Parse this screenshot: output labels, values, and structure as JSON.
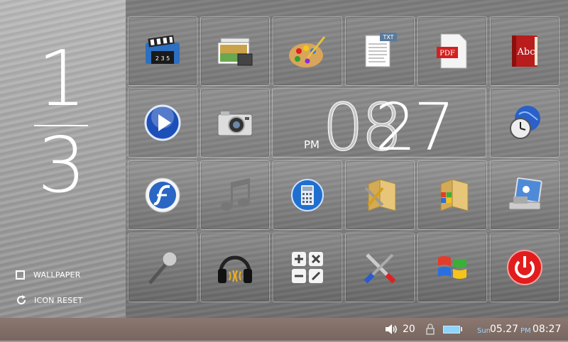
{
  "page_indicator": {
    "current": "1",
    "total": "3"
  },
  "options": {
    "wallpaper": "WALLPAPER",
    "icon_reset": "ICON RESET"
  },
  "clock": {
    "ampm": "PM",
    "hours": "08",
    "minutes": "27"
  },
  "tiles": [
    {
      "icon": "video-folder-icon"
    },
    {
      "icon": "photo-gallery-icon"
    },
    {
      "icon": "paint-palette-icon"
    },
    {
      "icon": "text-document-icon",
      "badge": "TXT"
    },
    {
      "icon": "pdf-document-icon",
      "badge": "PDF"
    },
    {
      "icon": "dictionary-book-icon",
      "badge": "Abc"
    },
    {
      "icon": "media-player-icon"
    },
    {
      "icon": "camera-icon"
    },
    {
      "icon": "world-clock-icon"
    },
    {
      "icon": "flash-player-icon"
    },
    {
      "icon": "music-note-icon"
    },
    {
      "icon": "calculator-icon"
    },
    {
      "icon": "tools-folder-icon"
    },
    {
      "icon": "windows-folder-icon"
    },
    {
      "icon": "display-settings-icon"
    },
    {
      "icon": "microphone-icon"
    },
    {
      "icon": "headphones-icon"
    },
    {
      "icon": "calculator-keypad-icon"
    },
    {
      "icon": "settings-tools-icon"
    },
    {
      "icon": "windows-logo-icon"
    },
    {
      "icon": "power-button-icon"
    }
  ],
  "status_bar": {
    "volume_level": "20",
    "day": "Sun",
    "date": "05.27",
    "ampm": "PM",
    "time": "08:27"
  },
  "colors": {
    "accent_blue": "#9fd6ff",
    "status_bar": "#7f6d66"
  }
}
